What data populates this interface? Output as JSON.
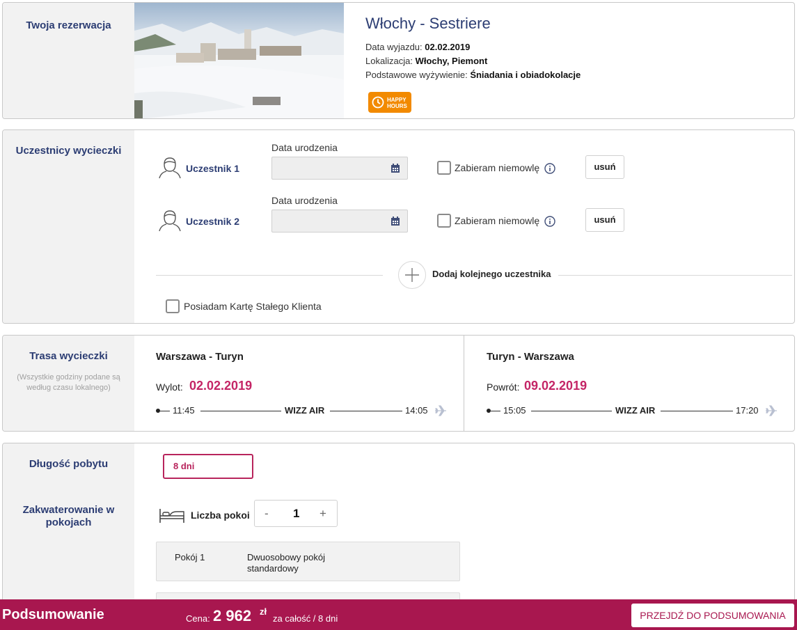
{
  "booking": {
    "section_title": "Twoja rezerwacja",
    "trip_title": "Włochy - Sestriere",
    "departure_label": "Data wyjazdu:",
    "departure_value": "02.02.2019",
    "location_label": "Lokalizacja:",
    "location_value": "Włochy, Piemont",
    "board_label": "Podstawowe wyżywienie:",
    "board_value": "Śniadania i obiadokolacje",
    "badge_line1": "HAPPY",
    "badge_line2": "HOURS"
  },
  "participants": {
    "section_title": "Uczestnicy wycieczki",
    "items": [
      {
        "name": "Uczestnik 1",
        "dob_label": "Data urodzenia",
        "dob_value": "",
        "infant_label": "Zabieram niemowlę",
        "delete_label": "usuń"
      },
      {
        "name": "Uczestnik 2",
        "dob_label": "Data urodzenia",
        "dob_value": "",
        "infant_label": "Zabieram niemowlę",
        "delete_label": "usuń"
      }
    ],
    "add_label": "Dodaj kolejnego uczestnika",
    "loyalty_label": "Posiadam Kartę Stałego Klienta"
  },
  "route": {
    "section_title": "Trasa wycieczki",
    "note": "(Wszystkie godziny podane są według czasu lokalnego)",
    "outbound": {
      "name": "Warszawa - Turyn",
      "date_label": "Wylot:",
      "date": "02.02.2019",
      "dep": "11:45",
      "airline": "WIZZ AIR",
      "arr": "14:05"
    },
    "inbound": {
      "name": "Turyn - Warszawa",
      "date_label": "Powrót:",
      "date": "09.02.2019",
      "dep": "15:05",
      "airline": "WIZZ AIR",
      "arr": "17:20"
    }
  },
  "stay": {
    "length_title": "Długość pobytu",
    "length_value": "8 dni",
    "rooms_title": "Zakwaterowanie w pokojach",
    "rooms_label": "Liczba pokoi",
    "rooms_minus": "-",
    "rooms_count": "1",
    "rooms_plus": "+",
    "room1_label": "Pokój 1",
    "room1_type": "Dwuosobowy pokój standardowy"
  },
  "footer": {
    "title": "Podsumowanie",
    "price_label": "Cena:",
    "price": "2 962",
    "currency": "zł",
    "period": "za całość / 8 dni",
    "cta": "PRZEJDŹ DO PODSUMOWANIA"
  },
  "colors": {
    "navy": "#2c3d73",
    "accent": "#a8174f",
    "date_pink": "#c42566",
    "badge_orange": "#f28a00"
  }
}
